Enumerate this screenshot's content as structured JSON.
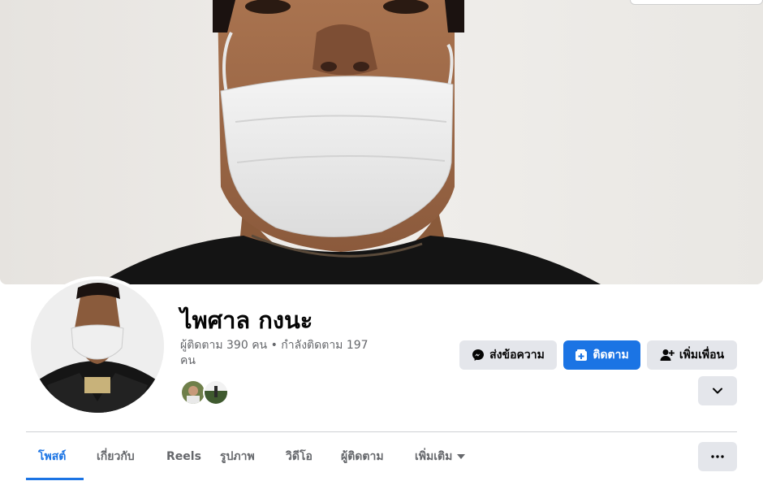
{
  "profile": {
    "name": "ไพศาล กงนะ",
    "stats": "ผู้ติดตาม 390 คน • กำลังติดตาม 197 คน"
  },
  "actions": {
    "message_label": "ส่งข้อความ",
    "follow_label": "ติดตาม",
    "add_friend_label": "เพิ่มเพื่อน"
  },
  "tabs": [
    {
      "label": "โพสต์",
      "active": true
    },
    {
      "label": "เกี่ยวกับ"
    },
    {
      "label": "Reels"
    },
    {
      "label": "รูปภาพ"
    },
    {
      "label": "วิดีโอ"
    },
    {
      "label": "ผู้ติดตาม"
    },
    {
      "label": "เพิ่มเติม"
    }
  ],
  "colors": {
    "accent": "#1b74e4",
    "button_gray": "#e4e6eb",
    "secondary_text": "#65676b",
    "divider": "#ced0d4"
  },
  "icons": [
    "messenger-icon",
    "follow-icon",
    "add-friend-icon",
    "chevron-down-icon",
    "more-icon",
    "caret-down-icon"
  ]
}
